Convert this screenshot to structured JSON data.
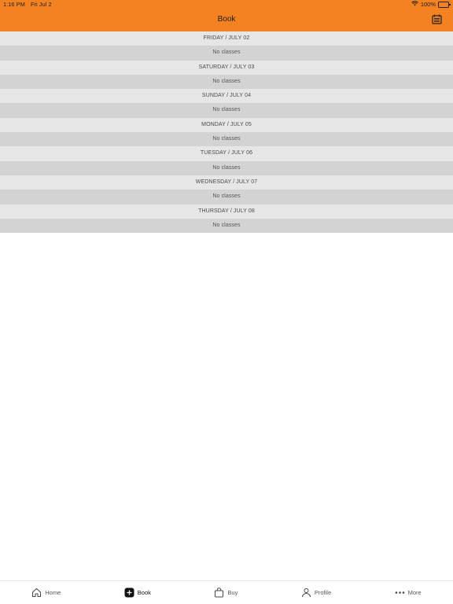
{
  "status_bar": {
    "time": "1:16 PM",
    "date": "Fri Jul 2",
    "battery": "100%"
  },
  "header": {
    "title": "Book",
    "calendar_icon": "calendar-icon",
    "color": "#f58220"
  },
  "schedule": [
    {
      "day": "FRIDAY / JULY 02",
      "status": "No classes"
    },
    {
      "day": "SATURDAY / JULY 03",
      "status": "No classes"
    },
    {
      "day": "SUNDAY / JULY 04",
      "status": "No classes"
    },
    {
      "day": "MONDAY / JULY 05",
      "status": "No classes"
    },
    {
      "day": "TUESDAY / JULY 06",
      "status": "No classes"
    },
    {
      "day": "WEDNESDAY / JULY 07",
      "status": "No classes"
    },
    {
      "day": "THURSDAY / JULY 08",
      "status": "No classes"
    }
  ],
  "tabs": [
    {
      "label": "Home",
      "icon": "home-icon"
    },
    {
      "label": "Book",
      "icon": "plus-icon",
      "active": true
    },
    {
      "label": "Buy",
      "icon": "shopping-bag-icon"
    },
    {
      "label": "Profile",
      "icon": "profile-icon"
    },
    {
      "label": "More",
      "icon": "more-icon"
    }
  ]
}
